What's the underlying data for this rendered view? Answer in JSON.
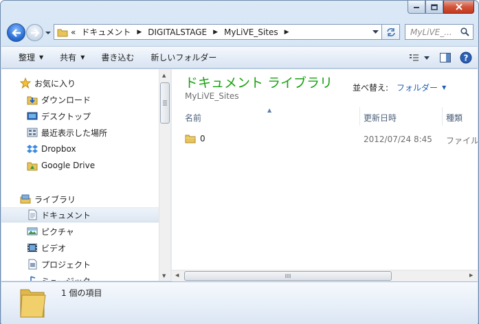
{
  "address": {
    "overflow": "«",
    "crumbs": [
      "ドキュメント",
      "DIGITALSTAGE",
      "MyLiVE_Sites"
    ]
  },
  "search": {
    "placeholder": "MyLiVE_..."
  },
  "toolbar": {
    "organize": "整理",
    "share": "共有",
    "burn": "書き込む",
    "new_folder": "新しいフォルダー"
  },
  "nav": {
    "favorites": {
      "header": "お気に入り",
      "items": [
        "ダウンロード",
        "デスクトップ",
        "最近表示した場所",
        "Dropbox",
        "Google Drive"
      ]
    },
    "libraries": {
      "header": "ライブラリ",
      "items": [
        "ドキュメント",
        "ピクチャ",
        "ビデオ",
        "プロジェクト",
        "ミュージック"
      ]
    }
  },
  "content": {
    "library_title": "ドキュメント ライブラリ",
    "library_subtitle": "MyLiVE_Sites",
    "arrange_label": "並べ替え:",
    "arrange_value": "フォルダー",
    "columns": {
      "name": "名前",
      "date": "更新日時",
      "type": "種類"
    },
    "files": [
      {
        "name": "0",
        "date": "2012/07/24 8:45",
        "type": "ファイル"
      }
    ]
  },
  "details": {
    "item_count": "1 個の項目"
  },
  "colors": {
    "accent_green": "#16a10e",
    "link_blue": "#1f5fb8",
    "folder_yellow": "#e8c45a"
  }
}
